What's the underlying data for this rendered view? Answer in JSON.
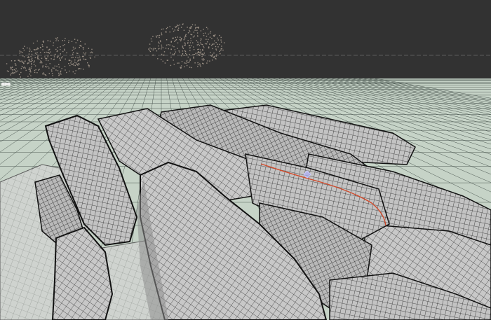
{
  "viewport": {
    "projection": "perspective",
    "shading": "wireframe",
    "origin_marker_text": "■■■"
  },
  "colors": {
    "background_top": "#323232",
    "horizon_line": "#6b6b6b",
    "ground": "#c6d3c7",
    "ground_grid": "#4a5650",
    "mesh_fill": "#bfbfbf",
    "mesh_wire": "#2a2a2a",
    "point_cloud": "#9a8f84",
    "selected_edge": "#d24a2a"
  },
  "icons": {
    "vertex_gizmo": "selected-vertex-icon"
  }
}
